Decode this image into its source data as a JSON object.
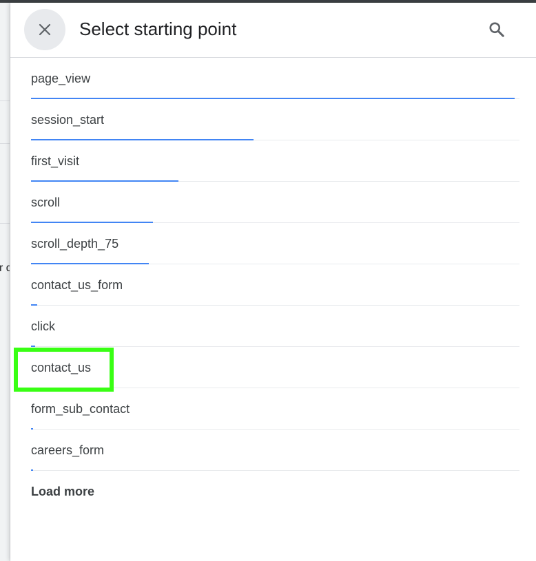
{
  "dialog": {
    "title": "Select starting point",
    "close_icon": "close-icon",
    "search_icon": "search-icon"
  },
  "background": {
    "partial_text": "r d"
  },
  "events": [
    {
      "label": "page_view",
      "bar_fraction": 0.99
    },
    {
      "label": "session_start",
      "bar_fraction": 0.455
    },
    {
      "label": "first_visit",
      "bar_fraction": 0.302
    },
    {
      "label": "scroll",
      "bar_fraction": 0.249
    },
    {
      "label": "scroll_depth_75",
      "bar_fraction": 0.241
    },
    {
      "label": "contact_us_form",
      "bar_fraction": 0.013
    },
    {
      "label": "click",
      "bar_fraction": 0.009
    },
    {
      "label": "contact_us",
      "bar_fraction": 0.0
    },
    {
      "label": "form_sub_contact",
      "bar_fraction": 0.004
    },
    {
      "label": "careers_form",
      "bar_fraction": 0.004
    }
  ],
  "load_more_label": "Load more",
  "colors": {
    "bar": "#4285f4",
    "highlight": "#39ff14",
    "text": "#3c4043"
  }
}
